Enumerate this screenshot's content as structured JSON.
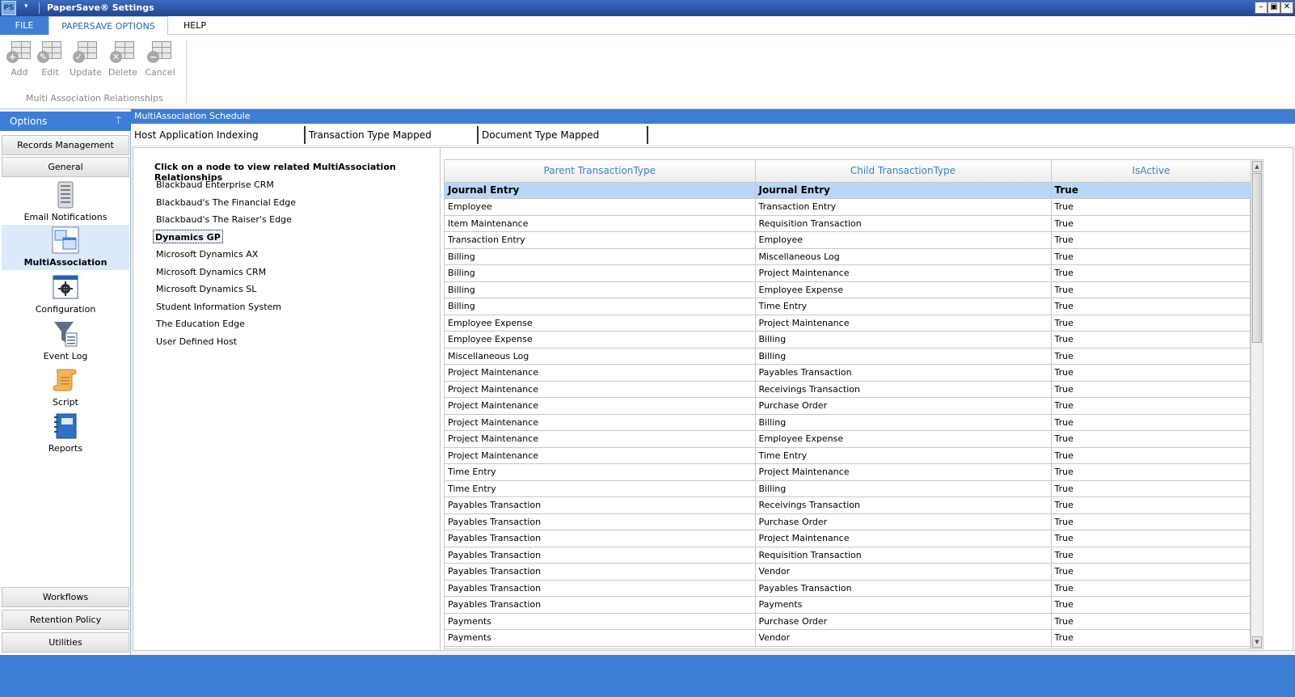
{
  "window": {
    "title": "PaperSave® Settings",
    "icon_text": "PS",
    "qat_glyph": "▾",
    "buttons": {
      "minimize": "–",
      "restore": "▣",
      "close": "✕"
    }
  },
  "menu": {
    "file": "FILE",
    "tabs": [
      "PAPERSAVE OPTIONS",
      "HELP"
    ]
  },
  "ribbon": {
    "buttons": [
      {
        "label": "Add",
        "badge": "+",
        "icon": "add-grid-icon"
      },
      {
        "label": "Edit",
        "badge": "✎",
        "icon": "edit-grid-icon"
      },
      {
        "label": "Update",
        "badge": "✓",
        "icon": "update-grid-icon"
      },
      {
        "label": "Delete",
        "badge": "✕",
        "icon": "delete-grid-icon"
      },
      {
        "label": "Cancel",
        "badge": "−",
        "icon": "cancel-grid-icon"
      }
    ],
    "group_label": "Multi Association Relationships"
  },
  "sidebar": {
    "header": "Options",
    "pin": "⍑",
    "top_buttons": [
      "Records Management",
      "General"
    ],
    "items": [
      {
        "label": "Email Notifications",
        "icon": "email-notifications-icon"
      },
      {
        "label": "MultiAssociation",
        "icon": "multiassociation-icon"
      },
      {
        "label": "Configuration",
        "icon": "configuration-gear-icon"
      },
      {
        "label": "Event Log",
        "icon": "event-log-funnel-icon"
      },
      {
        "label": "Script",
        "icon": "script-scroll-icon"
      },
      {
        "label": "Reports",
        "icon": "reports-book-icon"
      }
    ],
    "bottom_buttons": [
      "Workflows",
      "Retention Policy",
      "Utilities"
    ]
  },
  "main": {
    "header": "MultiAssociation Schedule",
    "tabs": [
      "Host Application Indexing Association",
      "Transaction Type Mapped Association",
      "Document Type Mapped Association"
    ],
    "tree": {
      "title": "Click on a node to view related MultiAssociation Relationships",
      "items": [
        "Blackbaud Enterprise CRM",
        "Blackbaud's The Financial Edge",
        "Blackbaud's The Raiser's Edge",
        "Dynamics GP",
        "Microsoft Dynamics AX",
        "Microsoft Dynamics CRM",
        "Microsoft Dynamics SL",
        "Student Information System",
        "The Education Edge",
        "User Defined Host"
      ]
    },
    "grid": {
      "columns": [
        "Parent TransactionType",
        "Child TransactionType",
        "IsActive"
      ],
      "rows": [
        [
          "Journal Entry",
          "Journal Entry",
          "True"
        ],
        [
          "Employee",
          "Transaction Entry",
          "True"
        ],
        [
          "Item Maintenance",
          "Requisition Transaction",
          "True"
        ],
        [
          "Transaction Entry",
          "Employee",
          "True"
        ],
        [
          "Billing",
          "Miscellaneous Log",
          "True"
        ],
        [
          "Billing",
          "Project Maintenance",
          "True"
        ],
        [
          "Billing",
          "Employee Expense",
          "True"
        ],
        [
          "Billing",
          "Time Entry",
          "True"
        ],
        [
          "Employee Expense",
          "Project Maintenance",
          "True"
        ],
        [
          "Employee Expense",
          "Billing",
          "True"
        ],
        [
          "Miscellaneous Log",
          "Billing",
          "True"
        ],
        [
          "Project Maintenance",
          "Payables Transaction",
          "True"
        ],
        [
          "Project Maintenance",
          "Receivings Transaction",
          "True"
        ],
        [
          "Project Maintenance",
          "Purchase Order",
          "True"
        ],
        [
          "Project Maintenance",
          "Billing",
          "True"
        ],
        [
          "Project Maintenance",
          "Employee Expense",
          "True"
        ],
        [
          "Project Maintenance",
          "Time Entry",
          "True"
        ],
        [
          "Time Entry",
          "Project Maintenance",
          "True"
        ],
        [
          "Time Entry",
          "Billing",
          "True"
        ],
        [
          "Payables Transaction",
          "Receivings Transaction",
          "True"
        ],
        [
          "Payables Transaction",
          "Purchase Order",
          "True"
        ],
        [
          "Payables Transaction",
          "Project Maintenance",
          "True"
        ],
        [
          "Payables Transaction",
          "Requisition Transaction",
          "True"
        ],
        [
          "Payables Transaction",
          "Vendor",
          "True"
        ],
        [
          "Payables Transaction",
          "Payables Transaction",
          "True"
        ],
        [
          "Payables Transaction",
          "Payments",
          "True"
        ],
        [
          "Payments",
          "Purchase Order",
          "True"
        ],
        [
          "Payments",
          "Vendor",
          "True"
        ]
      ]
    },
    "scroll": {
      "up": "▲",
      "down": "▼"
    }
  },
  "colors": {
    "accent": "#3d7fd6",
    "title_bar": "#22458f",
    "selected_row": "#b9d6f6"
  }
}
